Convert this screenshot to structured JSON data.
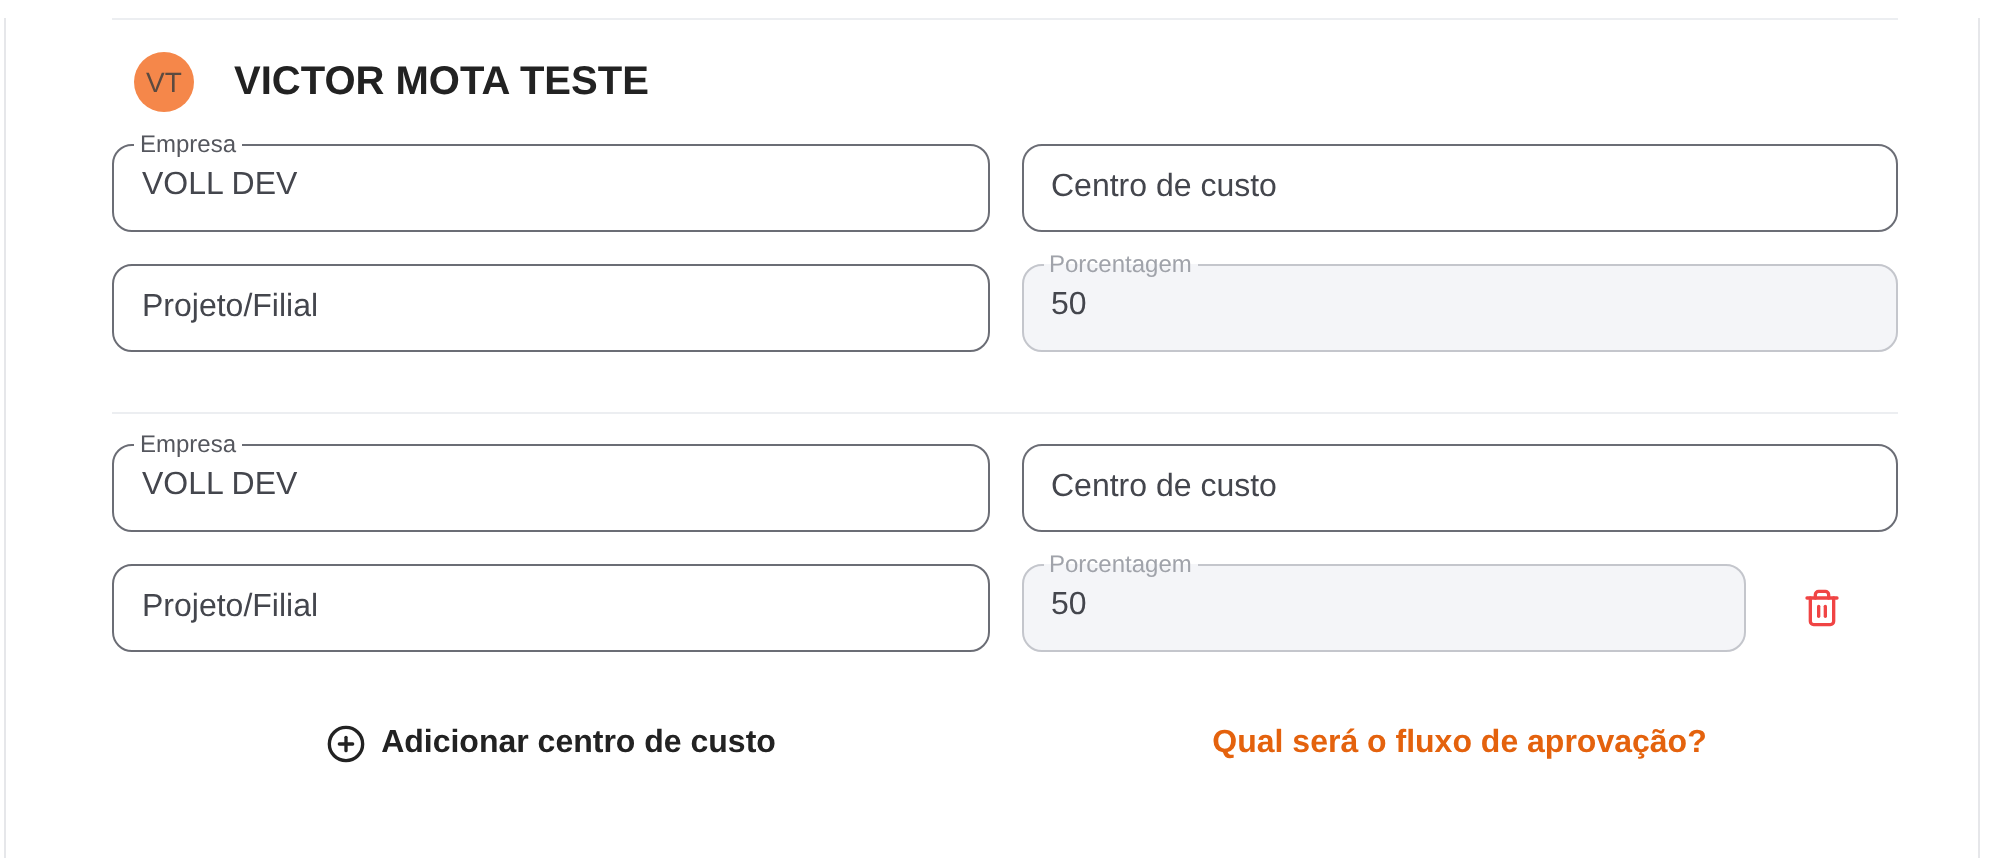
{
  "person": {
    "initials": "VT",
    "name": "VICTOR MOTA TESTE"
  },
  "cost_groups": [
    {
      "deletable": false,
      "fields": [
        {
          "label": "Empresa",
          "value": "VOLL DEV",
          "disabled": false
        },
        {
          "placeholder": "Centro de custo",
          "disabled": false
        },
        {
          "placeholder": "Projeto/Filial",
          "disabled": false
        },
        {
          "label": "Porcentagem",
          "value": "50",
          "disabled": true
        }
      ]
    },
    {
      "deletable": true,
      "fields": [
        {
          "label": "Empresa",
          "value": "VOLL DEV",
          "disabled": false
        },
        {
          "placeholder": "Centro de custo",
          "disabled": false
        },
        {
          "placeholder": "Projeto/Filial",
          "disabled": false
        },
        {
          "label": "Porcentagem",
          "value": "50",
          "disabled": true
        }
      ]
    }
  ],
  "add_button": "Adicionar centro de custo",
  "approval_link": "Qual será o fluxo de aprovação?"
}
